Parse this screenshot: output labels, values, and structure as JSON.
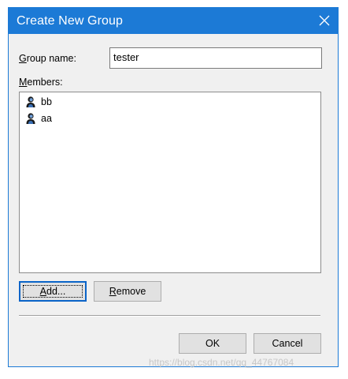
{
  "dialog": {
    "title": "Create New Group",
    "group_name_label_mnemonic": "G",
    "group_name_label_rest": "roup name:",
    "group_name_value": "tester",
    "members_label_mnemonic": "M",
    "members_label_rest": "embers:",
    "members": [
      {
        "name": "bb",
        "icon": "user-icon"
      },
      {
        "name": "aa",
        "icon": "user-icon"
      }
    ],
    "add_button": {
      "mnemonic": "A",
      "rest": "dd..."
    },
    "remove_button": {
      "mnemonic": "R",
      "rest": "emove"
    },
    "ok_label": "OK",
    "cancel_label": "Cancel"
  },
  "colors": {
    "titlebar": "#1c7ad6",
    "dialog_bg": "#f0f0f0",
    "button_bg": "#e1e1e1"
  },
  "watermark": "https://blog.csdn.net/qq_44767084"
}
